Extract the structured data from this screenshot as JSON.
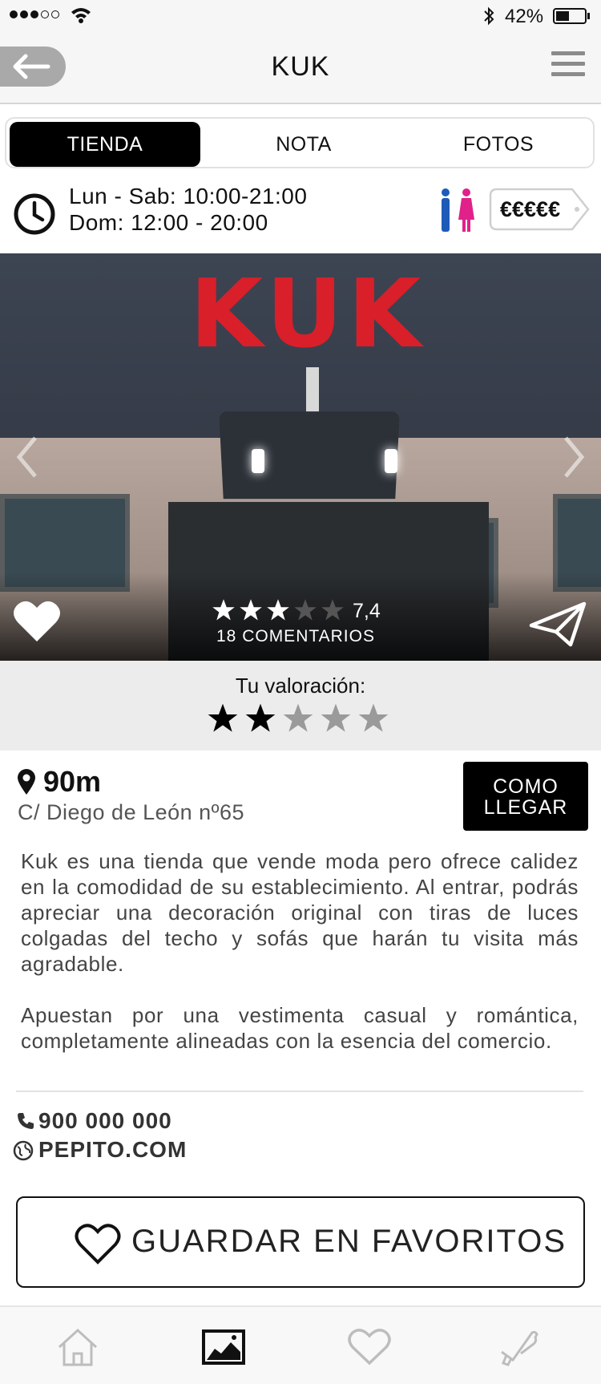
{
  "status_bar": {
    "battery": "42%"
  },
  "nav": {
    "title": "KUK"
  },
  "tabs": [
    {
      "label": "TIENDA",
      "active": true
    },
    {
      "label": "NOTA",
      "active": false
    },
    {
      "label": "FOTOS",
      "active": false
    }
  ],
  "hours": {
    "line1": "Lun - Sab: 10:00-21:00",
    "line2": "Dom: 12:00 - 20:00"
  },
  "price": "€€€€€",
  "photo": {
    "sign": "KUK",
    "stars": 3,
    "score": "7,4",
    "comments": "18  COMENTARIOS"
  },
  "user_rating": {
    "label": "Tu valoración:",
    "stars": 2,
    "max": 5
  },
  "location": {
    "distance": "90m",
    "address": "C/ Diego de León nº65",
    "route_line1": "COMO",
    "route_line2": "LLEGAR"
  },
  "description": {
    "p1": "Kuk es una tienda que vende moda pero ofrece calidez en la comodidad de su establecimiento. Al entrar, podrás apreciar una decoración original con tiras de luces colgadas del techo y sofás que harán tu visita más agradable.",
    "p2": "Apuestan por una vestimenta casual y romántica, completamente alineadas con la esencia del comercio."
  },
  "contact": {
    "phone": "900 000 000",
    "web": "PEPITO.COM"
  },
  "favorites_button": "GUARDAR EN FAVORITOS",
  "tab_bar": {
    "items": [
      "home-icon",
      "gallery-icon",
      "heart-icon",
      "megaphone-icon"
    ]
  },
  "colors": {
    "sign_red": "#d81f2a",
    "accent_black": "#000000",
    "back_gray": "#a9a9a9",
    "man_blue": "#1e5bb8",
    "woman_pink": "#e0218a"
  }
}
